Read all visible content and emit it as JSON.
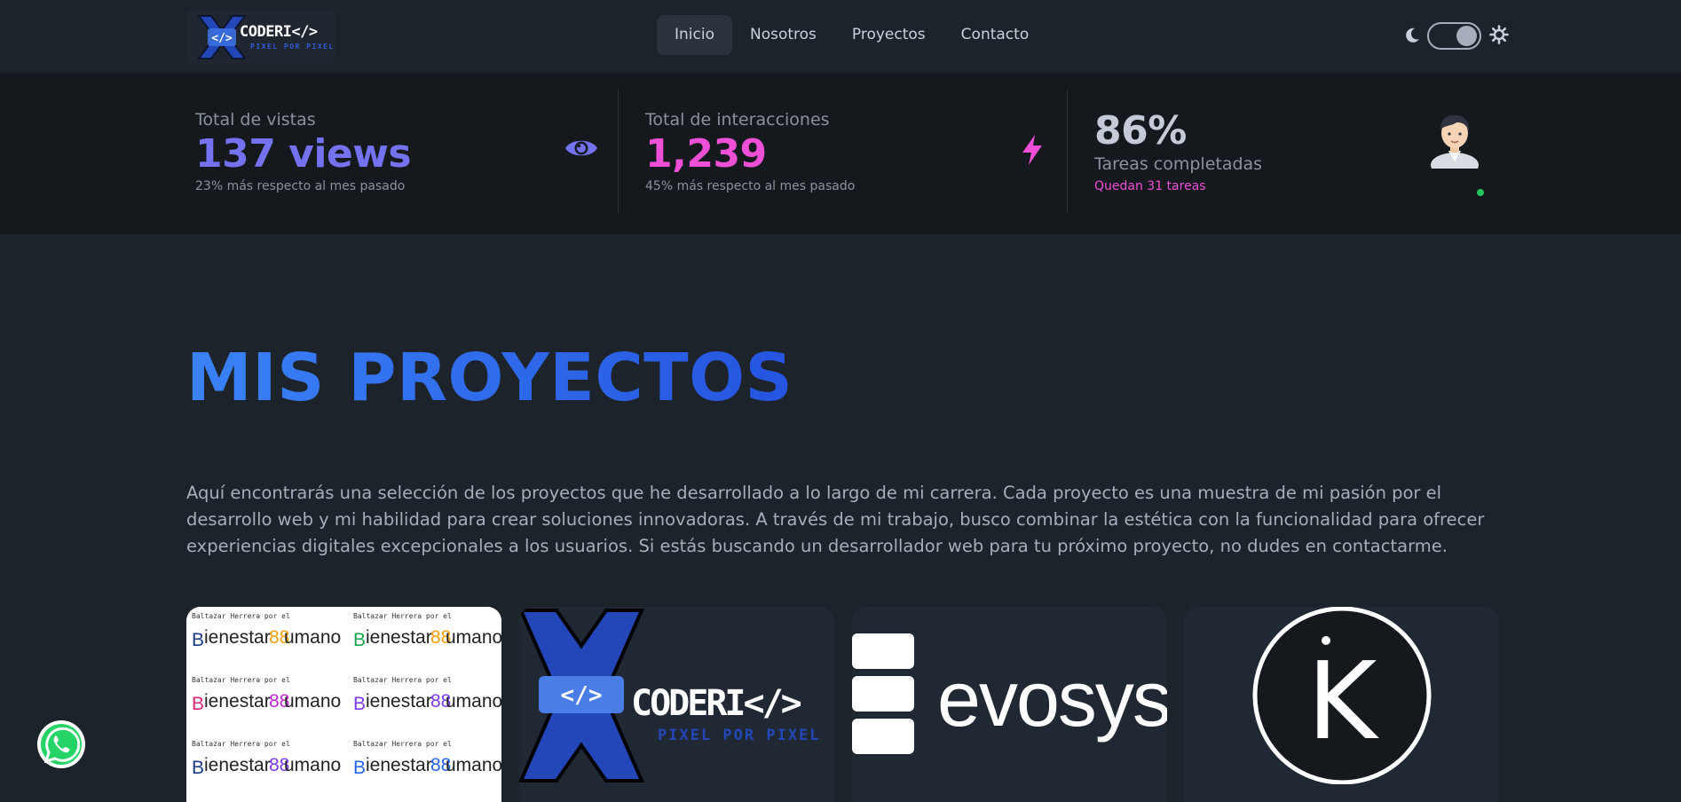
{
  "navbar": {
    "logo": {
      "wordmark": "CODERI</>",
      "tagline": "PIXEL POR PIXEL",
      "badge": "</>"
    },
    "menu": [
      "Inicio",
      "Nosotros",
      "Proyectos",
      "Contacto"
    ],
    "active": "Inicio",
    "theme_toggle": {
      "state": "dark",
      "icons": [
        "moon-icon",
        "sun-icon"
      ]
    }
  },
  "stats": [
    {
      "title": "Total de vistas",
      "value": "137 views",
      "desc": "23% más respecto al mes pasado",
      "icon": "eye-icon",
      "color": "#7472f0"
    },
    {
      "title": "Total de interacciones",
      "value": "1,239",
      "desc": "45% más respecto al mes pasado",
      "icon": "bolt-icon",
      "color": "#ee4fd7"
    },
    {
      "title": "Tareas completadas",
      "value": "86%",
      "desc": "Quedan 31 tareas",
      "icon": "avatar",
      "color": "#c4cbd6",
      "desc_color": "#ee4fd7"
    }
  ],
  "projects": {
    "heading": "MIS PROYECTOS",
    "intro": "Aquí encontrarás una selección de los proyectos que he desarrollado a lo largo de mi carrera. Cada proyecto es una muestra de mi pasión por el desarrollo web y mi habilidad para crear soluciones innovadoras. A través de mi trabajo, busco combinar la estética con la funcionalidad para ofrecer experiencias digitales excepcionales a los usuarios. Si estás buscando un desarrollador web para tu próximo proyecto, no dudes en contactarme.",
    "cards": [
      {
        "name": "bienestar-humano",
        "brand": {
          "line1": "Baltazar Herrera por el",
          "line2a": "ienestar",
          "line2b": "umano"
        }
      },
      {
        "name": "coderi",
        "brand": {
          "wordmark": "CODERI</>",
          "tagline": "PIXEL POR PIXEL",
          "badge": "</>"
        }
      },
      {
        "name": "evosys",
        "brand": {
          "wordmark": "evosys"
        }
      },
      {
        "name": "k-logo",
        "brand": {
          "letter": "K"
        }
      }
    ]
  },
  "floating": {
    "whatsapp": "whatsapp-icon"
  },
  "colors": {
    "bg": "#1d232a",
    "stats_bg": "#15191e",
    "accent_blue": "#3073f1",
    "accent_purple": "#7472f0",
    "accent_pink": "#ee4fd7"
  }
}
